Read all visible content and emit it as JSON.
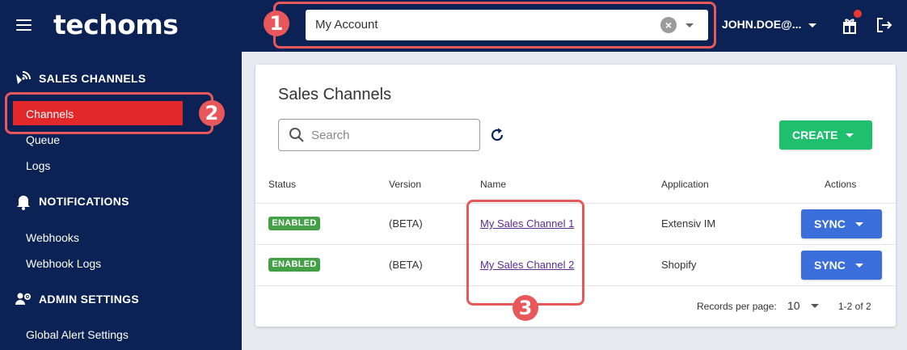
{
  "header": {
    "logo": "techoms",
    "account_select_value": "My Account",
    "user_label": "JOHN.DOE@..."
  },
  "sidebar": {
    "sections": [
      {
        "label": "SALES CHANNELS",
        "icon": "satellite-dish-icon",
        "items": [
          "Channels",
          "Queue",
          "Logs"
        ]
      },
      {
        "label": "NOTIFICATIONS",
        "icon": "bell-icon",
        "items": [
          "Webhooks",
          "Webhook Logs"
        ]
      },
      {
        "label": "ADMIN SETTINGS",
        "icon": "users-cog-icon",
        "items": [
          "Global Alert Settings"
        ]
      }
    ],
    "active_item": "Channels"
  },
  "main": {
    "title": "Sales Channels",
    "search_placeholder": "Search",
    "create_label": "CREATE",
    "columns": [
      "Status",
      "Version",
      "Name",
      "Application",
      "Actions"
    ],
    "rows": [
      {
        "status": "ENABLED",
        "version": "(BETA)",
        "name": "My Sales Channel 1",
        "application": "Extensiv IM",
        "action": "SYNC"
      },
      {
        "status": "ENABLED",
        "version": "(BETA)",
        "name": "My Sales Channel 2",
        "application": "Shopify",
        "action": "SYNC"
      }
    ],
    "footer": {
      "rows_per_page_label": "Records per page:",
      "rows_per_page_value": "10",
      "pagination": "1-2 of 2"
    }
  },
  "annotations": [
    "1",
    "2",
    "3"
  ],
  "colors": {
    "navy": "#0c2255",
    "active_red": "#e3282c",
    "annotation": "#e8585a",
    "create_green": "#1ec06e",
    "sync_blue": "#3a6edb",
    "badge_green": "#43a047",
    "link_purple": "#5b2c91"
  }
}
